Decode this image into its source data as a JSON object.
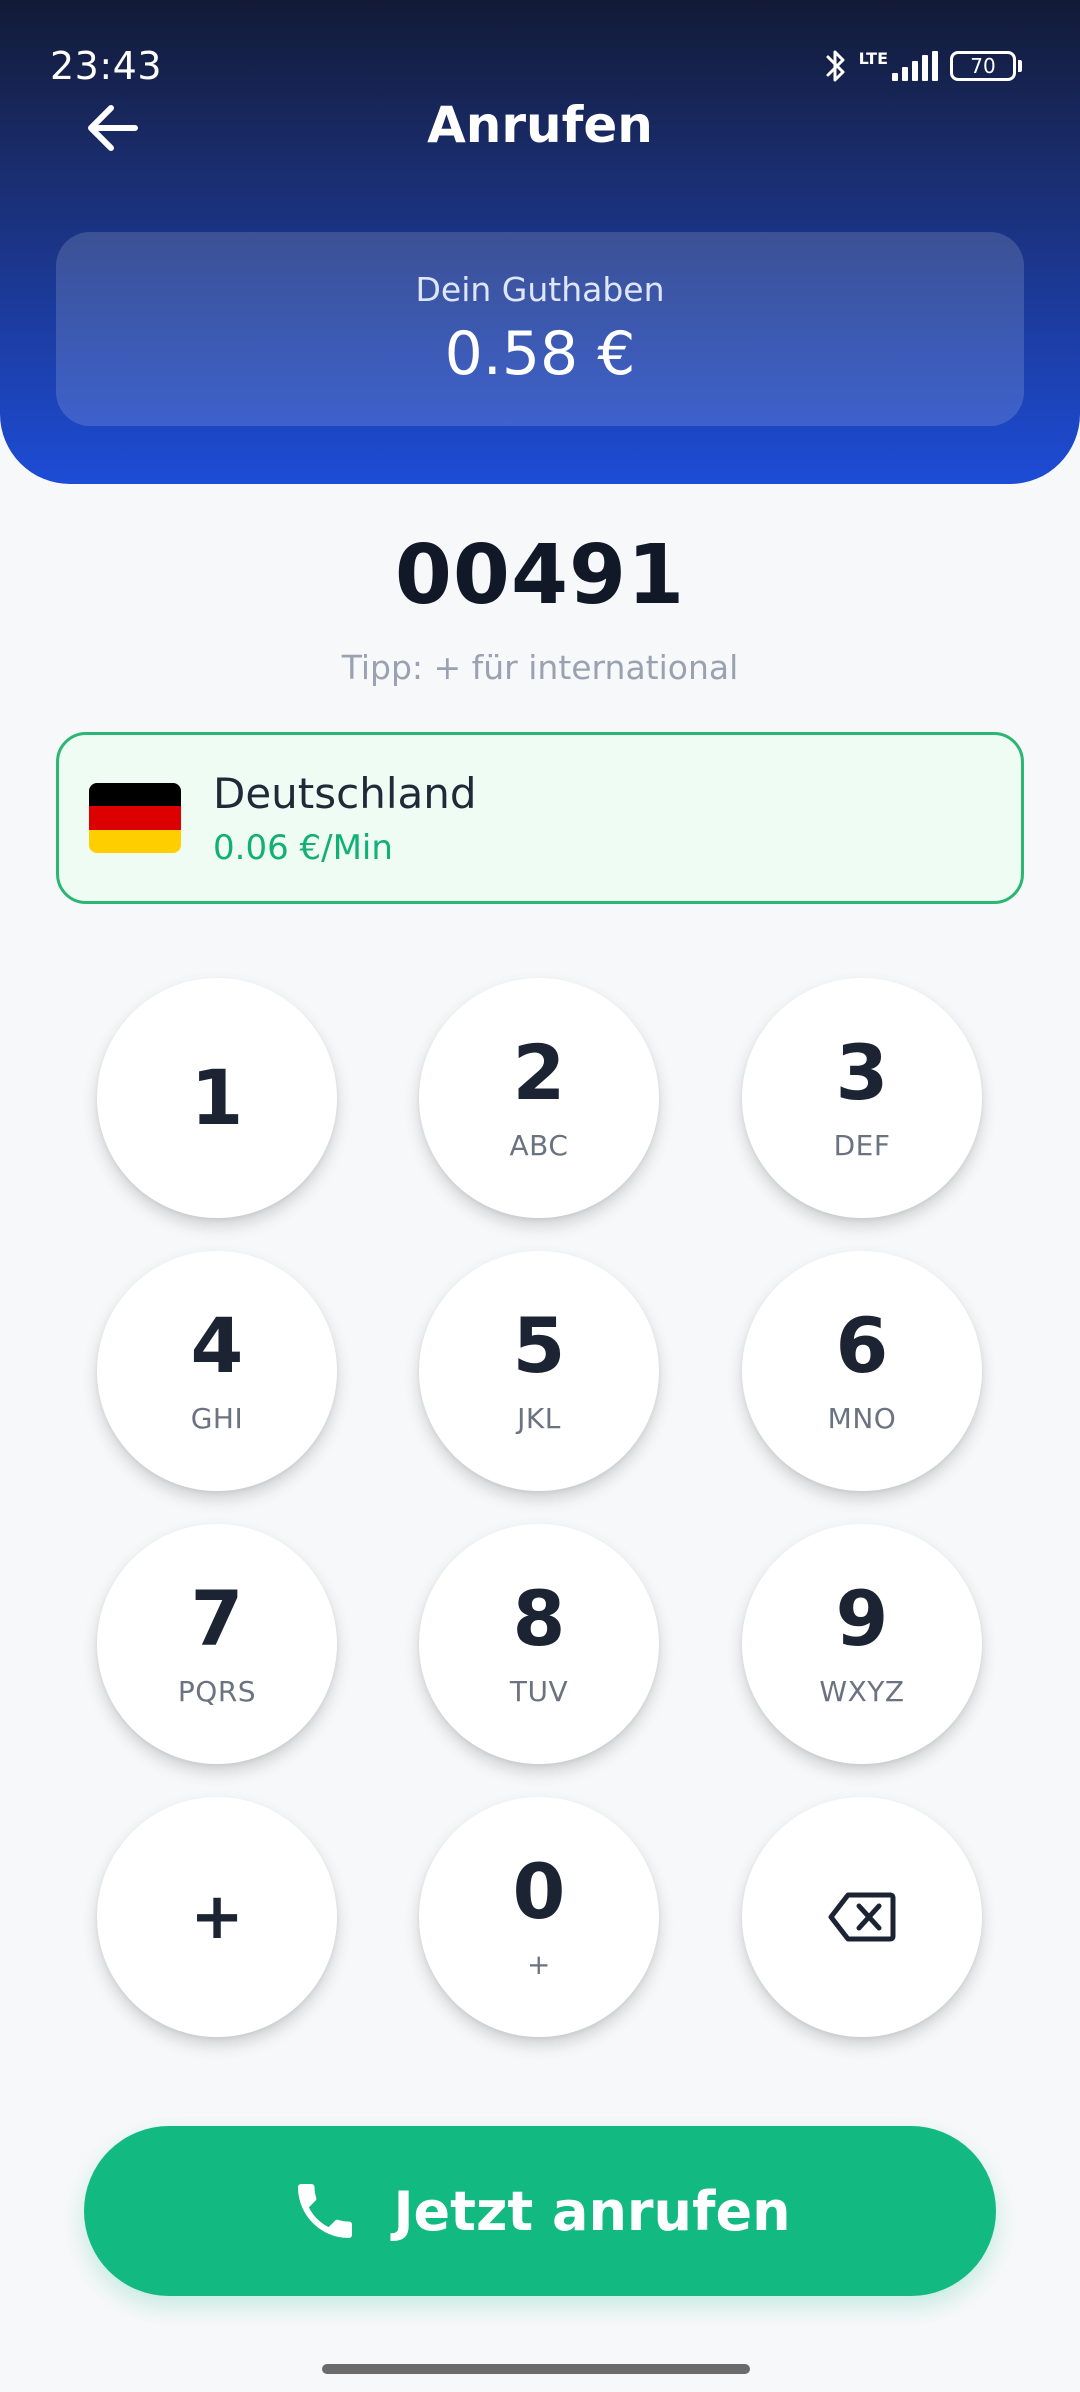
{
  "status_bar": {
    "time": "23:43",
    "network": "LTE",
    "battery": "70"
  },
  "header": {
    "title": "Anrufen",
    "back_icon": "arrow-left-icon"
  },
  "balance": {
    "label": "Dein Guthaben",
    "value": "0.58 €"
  },
  "dialer": {
    "number": "00491",
    "hint": "Tipp: + für international"
  },
  "country": {
    "name": "Deutschland",
    "rate": "0.06 €/Min",
    "flag_colors": [
      "#000000",
      "#dd0000",
      "#ffce00"
    ]
  },
  "keypad": [
    {
      "digit": "1",
      "letters": ""
    },
    {
      "digit": "2",
      "letters": "ABC"
    },
    {
      "digit": "3",
      "letters": "DEF"
    },
    {
      "digit": "4",
      "letters": "GHI"
    },
    {
      "digit": "5",
      "letters": "JKL"
    },
    {
      "digit": "6",
      "letters": "MNO"
    },
    {
      "digit": "7",
      "letters": "PQRS"
    },
    {
      "digit": "8",
      "letters": "TUV"
    },
    {
      "digit": "9",
      "letters": "WXYZ"
    },
    {
      "digit": "+",
      "letters": ""
    },
    {
      "digit": "0",
      "letters": "+"
    },
    {
      "digit": "",
      "letters": "",
      "icon": "backspace-icon"
    }
  ],
  "call_button": {
    "label": "Jetzt anrufen",
    "icon": "phone-icon",
    "color": "#12b981"
  },
  "colors": {
    "header_top": "#121a36",
    "header_bottom": "#1d4cd6",
    "accent_green": "#12b077"
  }
}
